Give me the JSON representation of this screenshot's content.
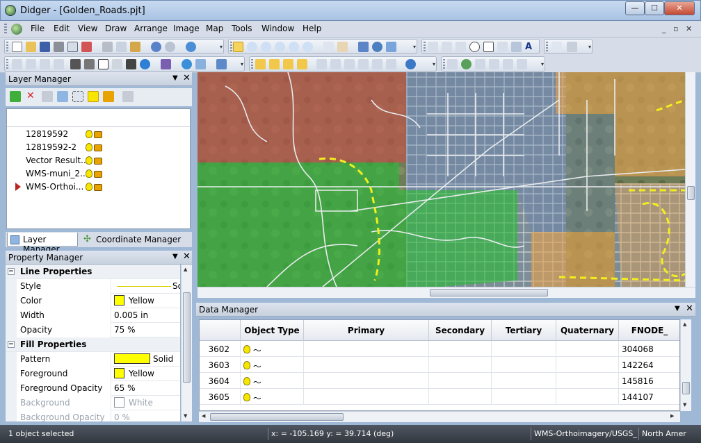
{
  "window": {
    "title": "Didger - [Golden_Roads.pjt]",
    "controls": {
      "minimize": "—",
      "maximize": "☐",
      "close": "✕"
    }
  },
  "menu": {
    "items": [
      "File",
      "Edit",
      "View",
      "Draw",
      "Arrange",
      "Image",
      "Map",
      "Tools",
      "Window",
      "Help"
    ],
    "mdi_controls": {
      "minimize": "_",
      "restore": "▫",
      "close": "✕"
    }
  },
  "layer_manager": {
    "title": "Layer Manager",
    "pin": "▼",
    "close": "✕",
    "layers": [
      {
        "name": "12819592"
      },
      {
        "name": "12819592-2"
      },
      {
        "name": "Vector Result..."
      },
      {
        "name": "WMS-muni_2..."
      },
      {
        "name": "WMS-Orthoi..."
      }
    ]
  },
  "bottom_tabs": {
    "layer_manager": "Layer Manager",
    "coordinate_manager": "Coordinate Manager"
  },
  "property_manager": {
    "title": "Property Manager",
    "pin": "▼",
    "close": "✕",
    "sections": {
      "line": "Line Properties",
      "fill": "Fill Properties"
    },
    "line": {
      "style_label": "Style",
      "style_value": "So",
      "color_label": "Color",
      "color_value": "Yellow",
      "width_label": "Width",
      "width_value": "0.005 in",
      "opacity_label": "Opacity",
      "opacity_value": "75 %"
    },
    "fill": {
      "pattern_label": "Pattern",
      "pattern_value": "Solid",
      "foreground_label": "Foreground",
      "foreground_value": "Yellow",
      "fg_opacity_label": "Foreground Opacity",
      "fg_opacity_value": "65 %",
      "background_label": "Background",
      "background_value": "White",
      "bg_opacity_label": "Background Opacity",
      "bg_opacity_value": "0 %"
    },
    "collapse_symbol": "−"
  },
  "data_manager": {
    "title": "Data Manager",
    "pin": "▼",
    "close": "✕",
    "columns": [
      "",
      "Object Type",
      "Primary",
      "Secondary",
      "Tertiary",
      "Quaternary",
      "FNODE_"
    ],
    "rows": [
      {
        "id": "3602",
        "fnode": "304068"
      },
      {
        "id": "3603",
        "fnode": "142264"
      },
      {
        "id": "3604",
        "fnode": "145816"
      },
      {
        "id": "3605",
        "fnode": "144107"
      }
    ]
  },
  "status": {
    "selection": "1 object selected",
    "coords": "x: = -105.169 y: = 39.714 (deg)",
    "source": "WMS-Orthoimagery/USGS_ED",
    "datum": "North Amer"
  },
  "colors": {
    "accent_yellow": "#ffff00",
    "map_red_zone": "#c4504a",
    "map_green_zone": "#2db83a",
    "map_orange_zone": "#e0a050",
    "map_blue_zone": "#6a86b8"
  }
}
